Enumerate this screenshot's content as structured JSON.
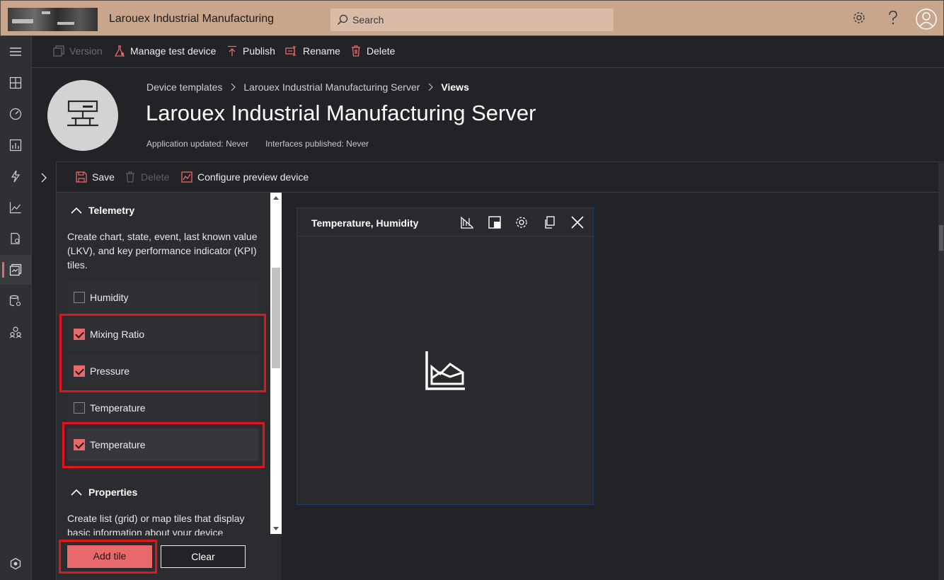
{
  "app": {
    "title": "Larouex Industrial Manufacturing"
  },
  "search": {
    "placeholder": "Search"
  },
  "toolbar": {
    "version_label": "Version",
    "manage_label": "Manage test device",
    "publish_label": "Publish",
    "rename_label": "Rename",
    "delete_label": "Delete"
  },
  "breadcrumb": {
    "items": [
      "Device templates",
      "Larouex Industrial Manufacturing Server",
      "Views"
    ]
  },
  "page": {
    "title": "Larouex Industrial Manufacturing Server",
    "app_updated": "Application updated: Never",
    "interfaces_published": "Interfaces published: Never"
  },
  "subtoolbar": {
    "save_label": "Save",
    "delete_label": "Delete",
    "configure_label": "Configure preview device"
  },
  "telemetry": {
    "heading": "Telemetry",
    "description": "Create chart, state, event, last known value (LKV), and key performance indicator (KPI) tiles.",
    "items": [
      {
        "label": "Humidity",
        "checked": false
      },
      {
        "label": "Mixing Ratio",
        "checked": true
      },
      {
        "label": "Pressure",
        "checked": true
      },
      {
        "label": "Temperature",
        "checked": false
      },
      {
        "label": "Temperature",
        "checked": true
      }
    ]
  },
  "properties": {
    "heading": "Properties",
    "description": "Create list (grid) or map tiles that display basic information about your device"
  },
  "buttons": {
    "add_tile": "Add tile",
    "clear": "Clear"
  },
  "tile": {
    "title": "Temperature, Humidity"
  },
  "colors": {
    "accent": "#e8696b",
    "topbar": "#c9a58b",
    "highlight": "#e3141e"
  }
}
